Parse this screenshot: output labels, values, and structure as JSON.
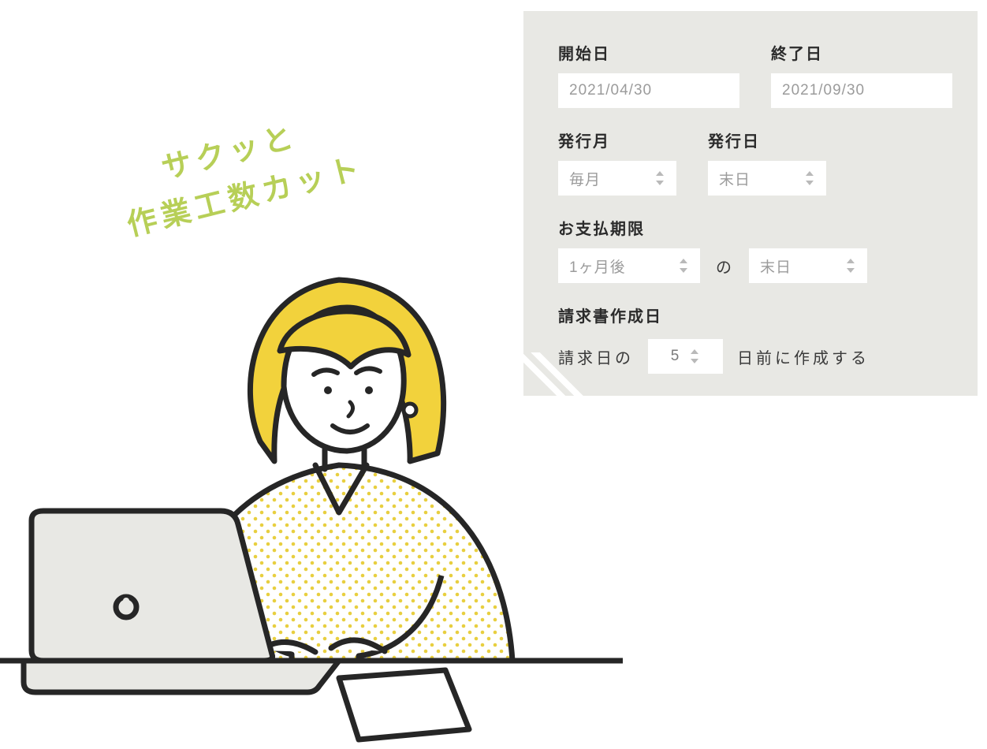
{
  "tagline": {
    "line1": "サクッと",
    "line2": "作業工数カット"
  },
  "form": {
    "start_date": {
      "label": "開始日",
      "value": "2021/04/30"
    },
    "end_date": {
      "label": "終了日",
      "value": "2021/09/30"
    },
    "issue_month": {
      "label": "発行月",
      "value": "毎月"
    },
    "issue_day": {
      "label": "発行日",
      "value": "末日"
    },
    "payment_due": {
      "label": "お支払期限",
      "offset": "1ヶ月後",
      "connector": "の",
      "day": "末日"
    },
    "create_day": {
      "label": "請求書作成日",
      "prefix": "請求日の",
      "days": "5",
      "suffix": "日前に作成する"
    }
  }
}
